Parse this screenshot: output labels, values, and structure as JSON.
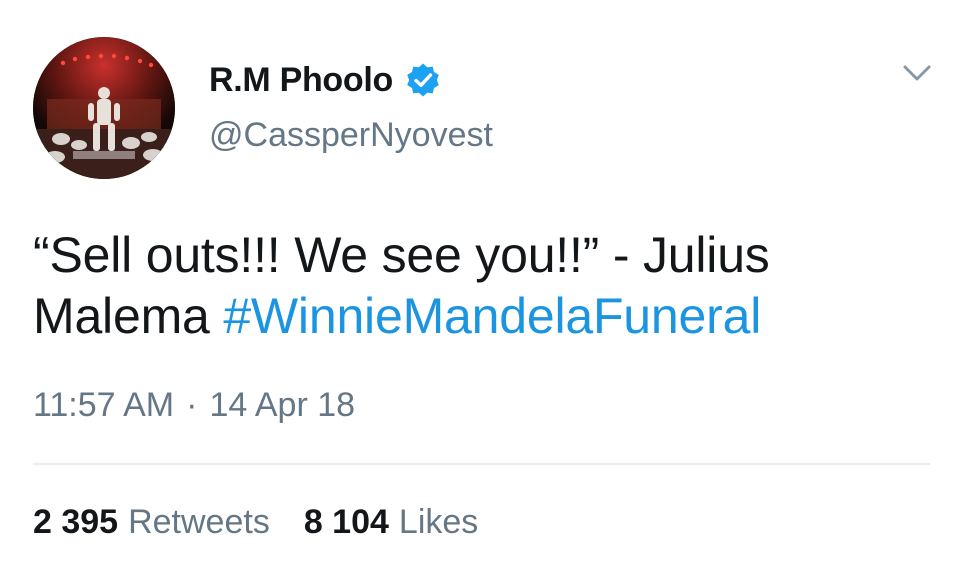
{
  "author": {
    "display_name": "R.M Phoolo",
    "handle": "@CassperNyovest",
    "verified": true,
    "avatar_icon": "concert-stage-photo"
  },
  "tweet": {
    "text_part1": "“Sell outs!!! We see you!!”  - Julius Malema ",
    "hashtag": "#WinnieMandelaFuneral",
    "time": "11:57 AM",
    "separator": "·",
    "date": "14 Apr 18"
  },
  "stats": {
    "retweets_count": "2 395",
    "retweets_label": "Retweets",
    "likes_count": "8 104",
    "likes_label": "Likes"
  },
  "colors": {
    "accent": "#1b95e0",
    "verified_badge": "#1da1f2",
    "text_primary": "#14171a",
    "text_secondary": "#657786"
  },
  "icons": {
    "verified": "verified-badge-icon",
    "menu": "chevron-down-icon"
  }
}
